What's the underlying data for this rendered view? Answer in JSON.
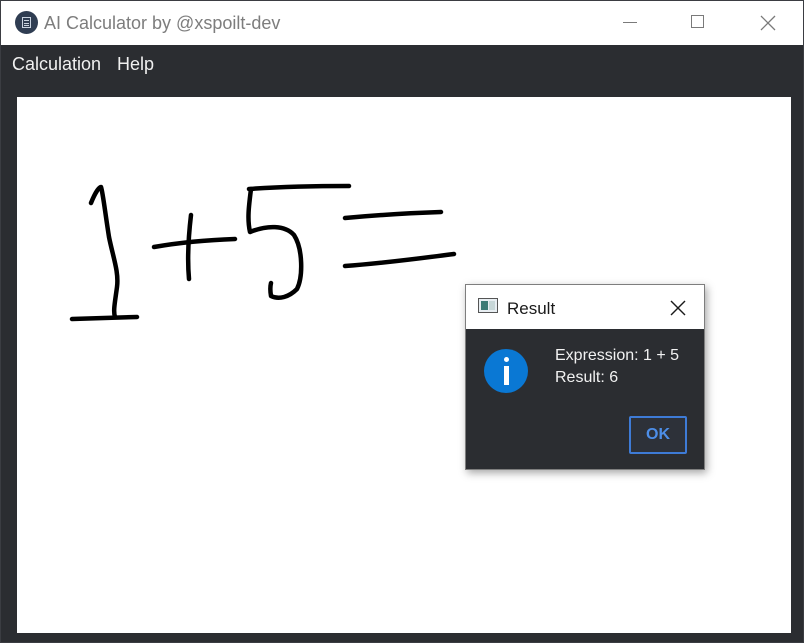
{
  "window": {
    "title": "AI Calculator by @xspoilt-dev",
    "icon": "calculator-icon",
    "controls": [
      "minimize-icon",
      "maximize-icon",
      "close-icon"
    ]
  },
  "menubar": {
    "items": [
      {
        "label": "Calculation"
      },
      {
        "label": "Help"
      }
    ]
  },
  "canvas": {
    "handwritten_content": "1+5=",
    "stroke_color": "#000000",
    "background": "#ffffff"
  },
  "dialog": {
    "title": "Result",
    "icon": "info-icon",
    "expression_line": "Expression: 1 + 5",
    "result_line": "Result: 6",
    "ok_label": "OK",
    "accent_color": "#3e7bd6"
  },
  "colors": {
    "chrome": "#2b2d31",
    "titlebar": "#ffffff",
    "info_blue": "#0a78d4"
  }
}
